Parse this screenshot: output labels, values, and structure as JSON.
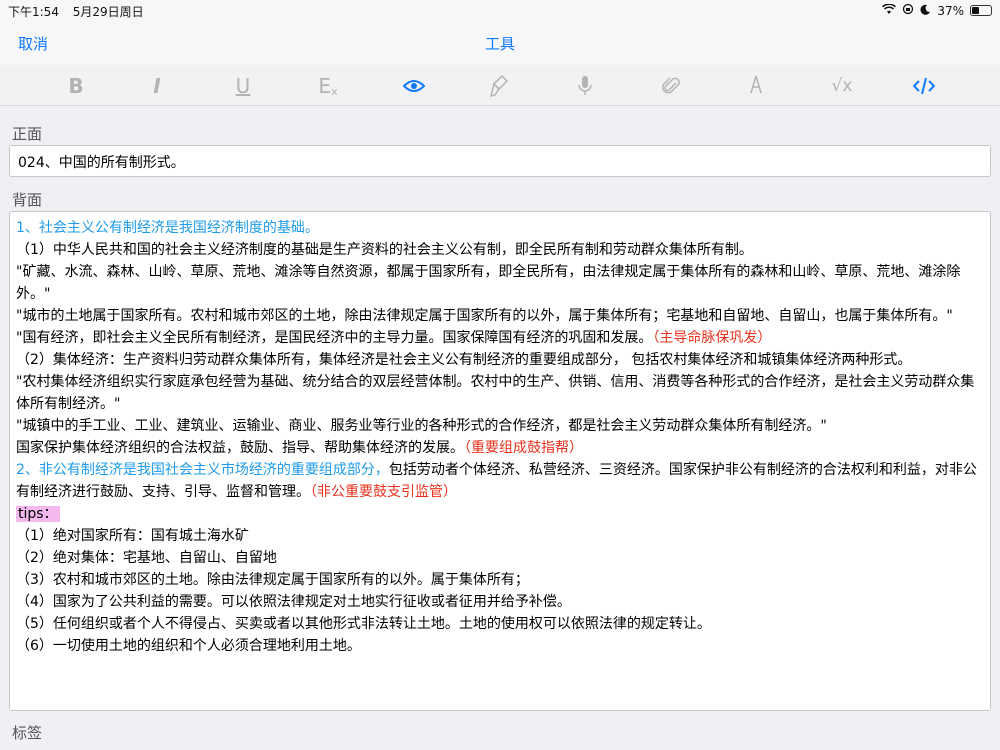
{
  "status_bar": {
    "time": "下午1:54",
    "date": "5月29日周日",
    "battery": "37%",
    "battery_level": 0.37
  },
  "nav": {
    "cancel": "取消",
    "title": "工具"
  },
  "toolbar": {
    "bold": "B",
    "italic": "I",
    "underline": "U",
    "clear_format": "E",
    "clear_sub": "x",
    "math": "√x"
  },
  "front": {
    "label": "正面",
    "value": "024、中国的所有制形式。"
  },
  "back": {
    "label": "背面",
    "lines": {
      "l1": "1、社会主义公有制经济是我国经济制度的基础。",
      "l2": "（1）中华人民共和国的社会主义经济制度的基础是生产资料的社会主义公有制，即全民所有制和劳动群众集体所有制。",
      "l3": "\"矿藏、水流、森林、山岭、草原、荒地、滩涂等自然资源，都属于国家所有，即全民所有，由法律规定属于集体所有的森林和山岭、草原、荒地、滩涂除外。\"",
      "l4": "\"城市的土地属于国家所有。农村和城市郊区的土地，除由法律规定属于国家所有的以外，属于集体所有；宅基地和自留地、自留山，也属于集体所有。\"",
      "l5a": "\"国有经济，即社会主义全民所有制经济，是国民经济中的主导力量。国家保障国有经济的巩固和发展。",
      "l5b": "（主导命脉保巩发）",
      "l6": "（2）集体经济：生产资料归劳动群众集体所有，集体经济是社会主义公有制经济的重要组成部分， 包括农村集体经济和城镇集体经济两种形式。",
      "l7": "\"农村集体经济组织实行家庭承包经营为基础、统分结合的双层经营体制。农村中的生产、供销、信用、消费等各种形式的合作经济，是社会主义劳动群众集 体所有制经济。\"",
      "l8": "\"城镇中的手工业、工业、建筑业、运输业、商业、服务业等行业的各种形式的合作经济，都是社会主义劳动群众集体所有制经济。\"",
      "l9a": "国家保护集体经济组织的合法权益，鼓励、指导、帮助集体经济的发展。",
      "l9b": "（重要组成鼓指帮）",
      "l10a": "2、非公有制经济是我国社会主义市场经济的重要组成部分，",
      "l10b": "包括劳动者个体经济、私营经济、三资经济。国家保护非公有制经济的合法权利和利益，对非公有制经济进行鼓励、支持、引导、监督和管理。",
      "l10c": "（非公重要鼓支引监管）",
      "tips": "tips：",
      "t1": "（1）绝对国家所有：国有城土海水矿",
      "t2": "（2）绝对集体：宅基地、自留山、自留地",
      "t3": "（3）农村和城市郊区的土地。除由法律规定属于国家所有的以外。属于集体所有；",
      "t4": "（4）国家为了公共利益的需要。可以依照法律规定对土地实行征收或者征用并给予补偿。",
      "t5": "（5）任何组织或者个人不得侵占、买卖或者以其他形式非法转让土地。土地的使用权可以依照法律的规定转让。",
      "t6": "（6）一切使用土地的组织和个人必须合理地利用土地。"
    }
  },
  "tags": {
    "label": "标签"
  },
  "colors": {
    "accent": "#0f7aff",
    "heading_blue": "#1e9bea",
    "mnemonic_red": "#e8321e",
    "highlight_pink": "#f5b8ee"
  },
  "icons": [
    "bold-icon",
    "italic-icon",
    "underline-icon",
    "clear-format-icon",
    "eye-icon",
    "brush-icon",
    "microphone-icon",
    "paperclip-icon",
    "pen-icon",
    "math-icon",
    "code-icon"
  ]
}
